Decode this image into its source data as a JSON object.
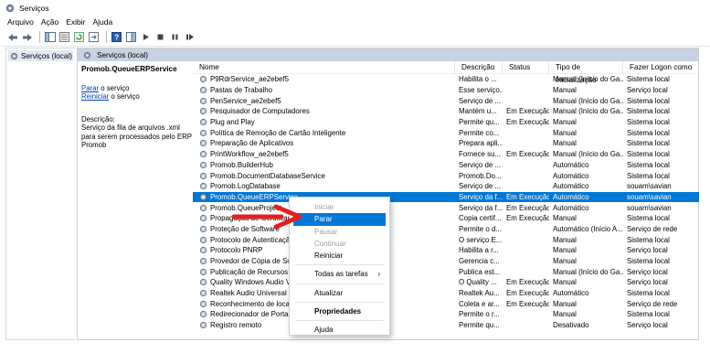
{
  "window": {
    "title": "Serviços"
  },
  "menu": [
    "Arquivo",
    "Ação",
    "Exibir",
    "Ajuda"
  ],
  "tree": {
    "item": "Serviços (local)"
  },
  "panel": {
    "header": "Serviços (local)",
    "service_name": "Promob.QueueERPService",
    "stop_link": "Parar",
    "stop_suffix": " o serviço",
    "restart_link": "Reiniciar",
    "restart_suffix": " o serviço",
    "desc_label": "Descrição:",
    "desc_text": "Serviço da fila de arquivos .xml para serem processados pelo ERP Promob"
  },
  "columns": [
    "Nome",
    "Descrição",
    "Status",
    "Tipo de Inicialização",
    "Fazer Logon como"
  ],
  "rows": [
    [
      "P9RdrService_ae2ebef5",
      "Habilita o ...",
      "",
      "Manual (Início do Ga...",
      "Sistema local"
    ],
    [
      "Pastas de Trabalho",
      "Esse serviço...",
      "",
      "Manual",
      "Serviço local"
    ],
    [
      "PenService_ae2ebef5",
      "Serviço de ...",
      "",
      "Manual (Início do Ga...",
      "Sistema local"
    ],
    [
      "Pesquisador de Computadores",
      "Mantém u...",
      "Em Execução",
      "Manual (Início do Ga...",
      "Sistema local"
    ],
    [
      "Plug and Play",
      "Permite qu...",
      "Em Execução",
      "Manual",
      "Sistema local"
    ],
    [
      "Política de Remoção de Cartão Inteligente",
      "Permite co...",
      "",
      "Manual",
      "Sistema local"
    ],
    [
      "Preparação de Aplicativos",
      "Prepara apli...",
      "",
      "Manual",
      "Sistema local"
    ],
    [
      "PrintWorkflow_ae2ebef5",
      "Fornece su...",
      "Em Execução",
      "Manual (Início do Ga...",
      "Sistema local"
    ],
    [
      "Promob.BuilderHub",
      "Serviço de ...",
      "",
      "Automático",
      "Sistema local"
    ],
    [
      "Promob.DocumentDatabaseService",
      "Promob.Do...",
      "",
      "Automático",
      "Sistema local"
    ],
    [
      "Promob.LogDatabase",
      "Serviço de ...",
      "",
      "Automático",
      "souam\\savian"
    ],
    [
      "Promob.QueueERPService",
      "Serviço da f...",
      "Em Execução",
      "Automático",
      "souam\\savian"
    ],
    [
      "Promob.QueueProject",
      "Serviço da f...",
      "Em Execução",
      "Automático",
      "souam\\savian"
    ],
    [
      "Propagação de Certificado",
      "Copia certif...",
      "Em Execução",
      "Manual",
      "Sistema local"
    ],
    [
      "Proteção de Software",
      "Permite o d...",
      "",
      "Automático (Início A...",
      "Serviço de rede"
    ],
    [
      "Protocolo de Autenticação",
      "O serviço E...",
      "",
      "Manual",
      "Sistema local"
    ],
    [
      "Protocolo PNRP",
      "Habilita a r...",
      "",
      "Manual",
      "Serviço local"
    ],
    [
      "Provedor de Cópia de Sombra",
      "Gerencia c...",
      "",
      "Manual",
      "Sistema local"
    ],
    [
      "Publicação de Recursos de",
      "Publica est...",
      "",
      "Manual (Início do Ga...",
      "Serviço local"
    ],
    [
      "Quality Windows Audio Vi",
      "O Quality ...",
      "Em Execução",
      "Manual",
      "Serviço local"
    ],
    [
      "Realtek Audio Universal Se",
      "Realtek Au...",
      "Em Execução",
      "Automático",
      "Sistema local"
    ],
    [
      "Reconhecimento de locais",
      "Coleta e ar...",
      "Em Execução",
      "Manual",
      "Serviço de rede"
    ],
    [
      "Redirecionador de Portas de Área de Trabalho",
      "Permite o r...",
      "",
      "Manual",
      "Sistema local"
    ],
    [
      "Registro remoto",
      "Permite qu...",
      "",
      "Desativado",
      "Serviço local"
    ]
  ],
  "selected_index": 11,
  "context_menu": [
    {
      "label": "Iniciar",
      "state": "disabled"
    },
    {
      "label": "Parar",
      "state": "highlighted"
    },
    {
      "label": "Pausar",
      "state": "disabled"
    },
    {
      "label": "Continuar",
      "state": "disabled"
    },
    {
      "label": "Reiniciar",
      "state": "normal"
    },
    {
      "sep": true
    },
    {
      "label": "Todas as tarefas",
      "state": "normal",
      "submenu": true
    },
    {
      "sep": true
    },
    {
      "label": "Atualizar",
      "state": "normal"
    },
    {
      "sep": true
    },
    {
      "label": "Propriedades",
      "state": "bold"
    },
    {
      "sep": true
    },
    {
      "label": "Ajuda",
      "state": "normal"
    }
  ],
  "colors": {
    "selection": "#0078d7",
    "panel_header": "#c7d3e2",
    "annotation_arrow": "#e02020"
  }
}
